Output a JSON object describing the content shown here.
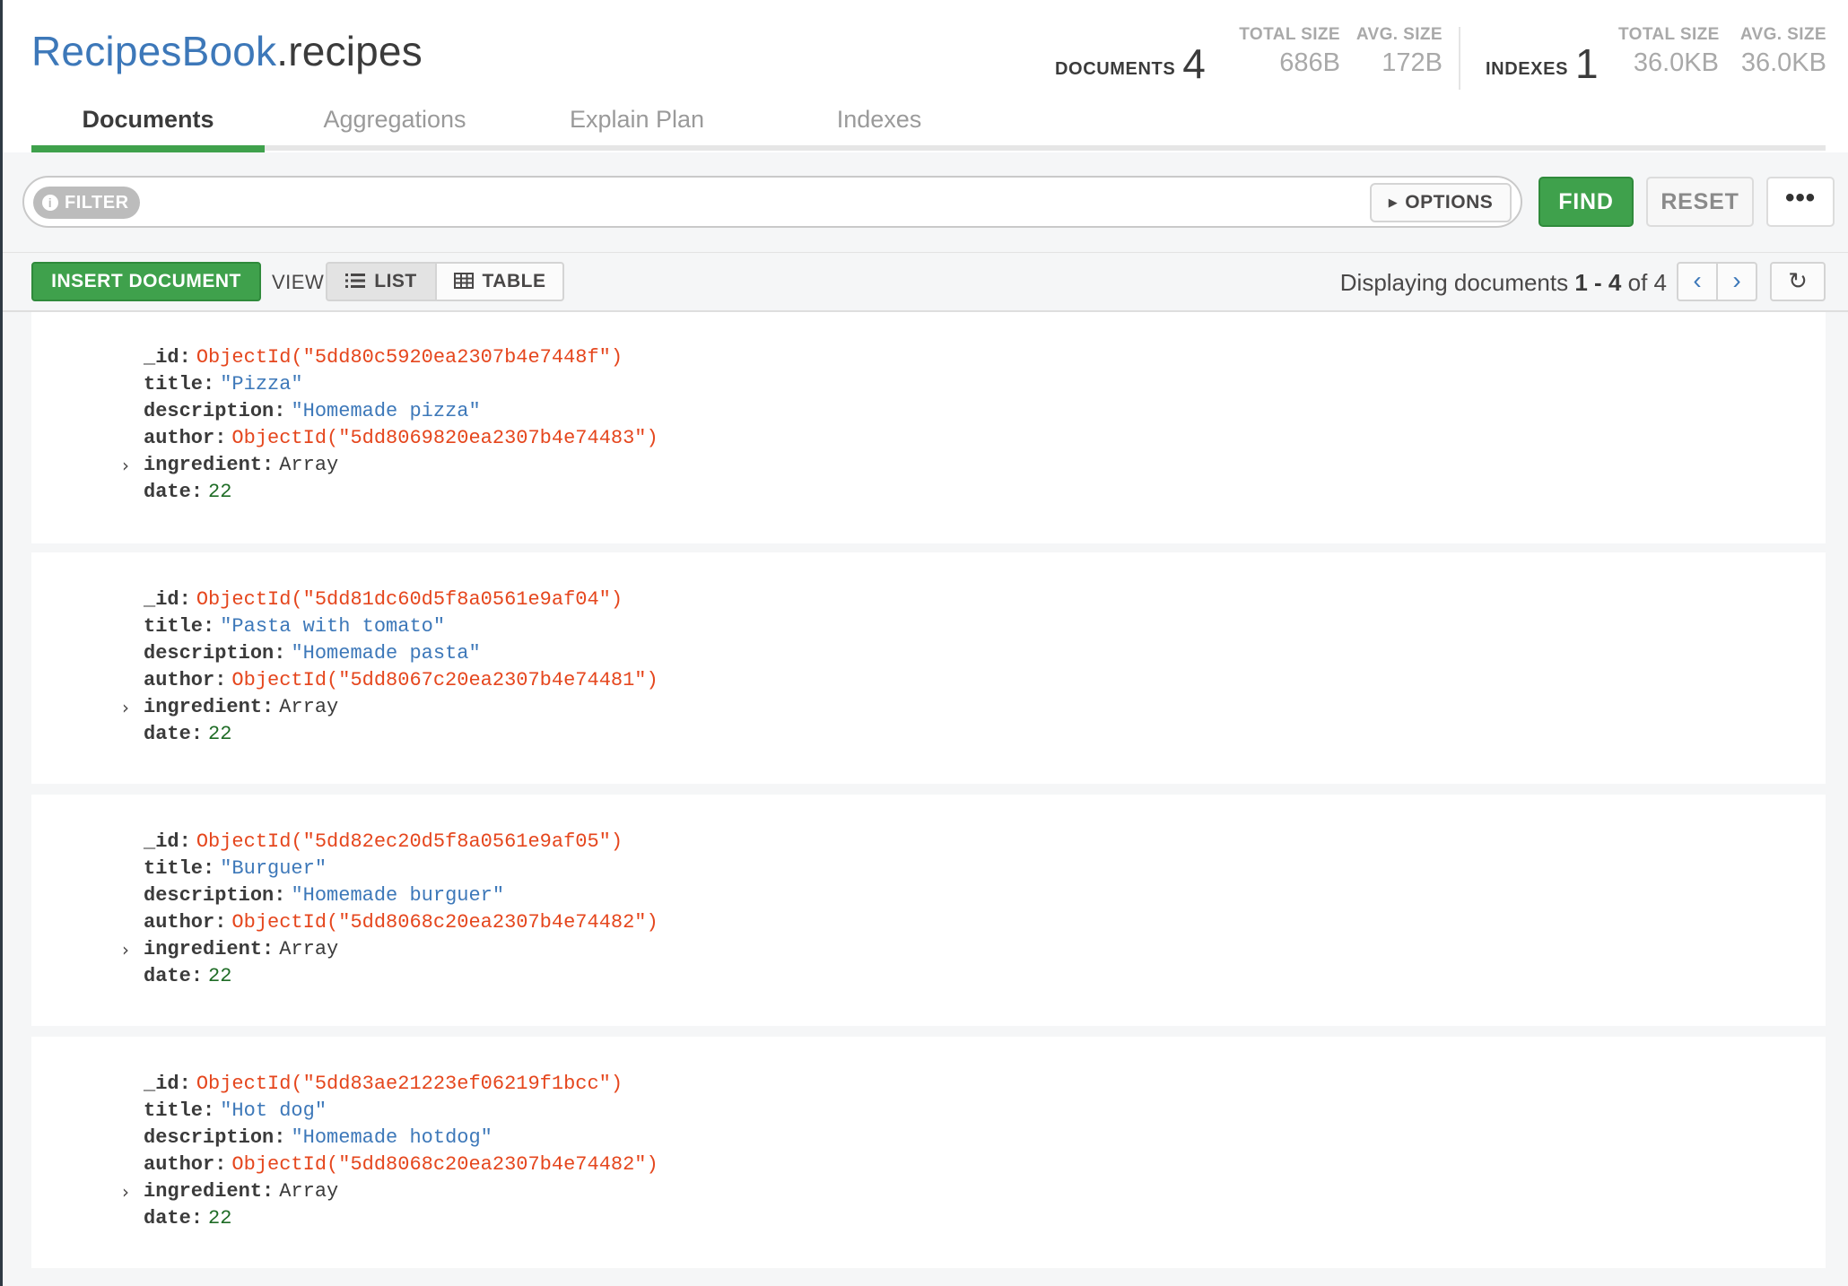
{
  "namespace": {
    "database": "RecipesBook",
    "collection": ".recipes"
  },
  "stats": {
    "documents": {
      "label": "DOCUMENTS",
      "count": "4",
      "total_size_label": "TOTAL SIZE",
      "total_size": "686B",
      "avg_size_label": "AVG. SIZE",
      "avg_size": "172B"
    },
    "indexes": {
      "label": "INDEXES",
      "count": "1",
      "total_size_label": "TOTAL SIZE",
      "total_size": "36.0KB",
      "avg_size_label": "AVG. SIZE",
      "avg_size": "36.0KB"
    }
  },
  "tabs": [
    {
      "label": "Documents",
      "active": true
    },
    {
      "label": "Aggregations",
      "active": false
    },
    {
      "label": "Explain Plan",
      "active": false
    },
    {
      "label": "Indexes",
      "active": false
    }
  ],
  "query_bar": {
    "filter_label": "FILTER",
    "filter_value": "",
    "options_label": "OPTIONS",
    "find_label": "FIND",
    "reset_label": "RESET",
    "more_label": "•••"
  },
  "toolbar": {
    "insert_label": "INSERT DOCUMENT",
    "view_label": "VIEW",
    "list_label": "LIST",
    "table_label": "TABLE",
    "display_prefix": "Displaying documents",
    "display_range": "1 - 4",
    "display_of": "of 4"
  },
  "documents": [
    {
      "_id": "ObjectId(\"5dd80c5920ea2307b4e7448f\")",
      "title": "\"Pizza\"",
      "description": "\"Homemade pizza\"",
      "author": "ObjectId(\"5dd8069820ea2307b4e74483\")",
      "ingredient": "Array",
      "date": "22"
    },
    {
      "_id": "ObjectId(\"5dd81dc60d5f8a0561e9af04\")",
      "title": "\"Pasta with tomato\"",
      "description": "\"Homemade pasta\"",
      "author": "ObjectId(\"5dd8067c20ea2307b4e74481\")",
      "ingredient": "Array",
      "date": "22"
    },
    {
      "_id": "ObjectId(\"5dd82ec20d5f8a0561e9af05\")",
      "title": "\"Burguer\"",
      "description": "\"Homemade burguer\"",
      "author": "ObjectId(\"5dd8068c20ea2307b4e74482\")",
      "ingredient": "Array",
      "date": "22"
    },
    {
      "_id": "ObjectId(\"5dd83ae21223ef06219f1bcc\")",
      "title": "\"Hot dog\"",
      "description": "\"Homemade hotdog\"",
      "author": "ObjectId(\"5dd8068c20ea2307b4e74482\")",
      "ingredient": "Array",
      "date": "22"
    }
  ],
  "field_keys": {
    "id": "_id",
    "title": "title",
    "description": "description",
    "author": "author",
    "ingredient": "ingredient",
    "date": "date"
  },
  "colors": {
    "accent_green": "#3fa14c",
    "namespace_blue": "#3d78b9",
    "objectid_red": "#e5461d",
    "number_green": "#1f6c26"
  }
}
